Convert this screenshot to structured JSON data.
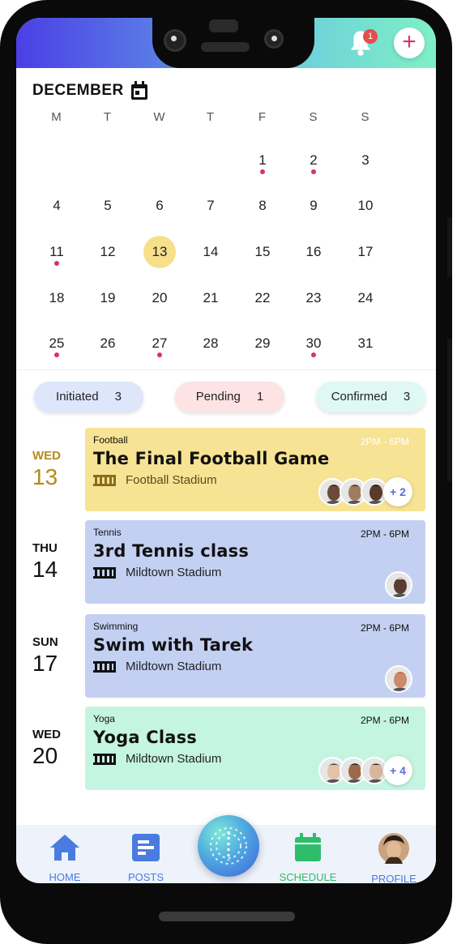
{
  "header": {
    "notification_count": "1",
    "add_label": "+"
  },
  "calendar": {
    "month": "DECEMBER",
    "weekdays": [
      "M",
      "T",
      "W",
      "T",
      "F",
      "S",
      "S"
    ],
    "days": [
      "1",
      "2",
      "3",
      "4",
      "5",
      "6",
      "7",
      "8",
      "9",
      "10",
      "11",
      "12",
      "13",
      "14",
      "15",
      "16",
      "17",
      "18",
      "19",
      "20",
      "21",
      "22",
      "23",
      "24",
      "25",
      "26",
      "27",
      "28",
      "29",
      "30",
      "31"
    ],
    "today": "13",
    "event_days": [
      "1",
      "2",
      "11",
      "25",
      "27",
      "30"
    ]
  },
  "filters": [
    {
      "label": "Initiated",
      "count": "3",
      "color": "#dde6fb"
    },
    {
      "label": "Pending",
      "count": "1",
      "color": "#fde3e3"
    },
    {
      "label": "Confirmed",
      "count": "3",
      "color": "#dff8f3"
    }
  ],
  "events": [
    {
      "dow": "WED",
      "date": "13",
      "category": "Football",
      "time": "2PM - 6PM",
      "title": "The Final Football Game",
      "location": "Football Stadium",
      "more": "+ 2",
      "color": "#f7e394",
      "date_color": "#b48a1c"
    },
    {
      "dow": "THU",
      "date": "14",
      "category": "Tennis",
      "time": "2PM - 6PM",
      "title": "3rd Tennis class",
      "location": "Mildtown Stadium",
      "more": "",
      "color": "#c4d0f2",
      "date_color": "#111111"
    },
    {
      "dow": "SUN",
      "date": "17",
      "category": "Swimming",
      "time": "2PM - 6PM",
      "title": "Swim with Tarek",
      "location": "Mildtown Stadium",
      "more": "",
      "color": "#c4d0f2",
      "date_color": "#111111"
    },
    {
      "dow": "WED",
      "date": "20",
      "category": "Yoga",
      "time": "2PM - 6PM",
      "title": "Yoga Class",
      "location": "Mildtown Stadium",
      "more": "+ 4",
      "color": "#c4f5e0",
      "date_color": "#111111"
    }
  ],
  "nav": {
    "home": "HOME",
    "posts": "POSTS",
    "schedule": "SCHEDULE",
    "profile": "PROFILE",
    "home_color": "#4a7be0",
    "schedule_color": "#2ebd6b"
  }
}
